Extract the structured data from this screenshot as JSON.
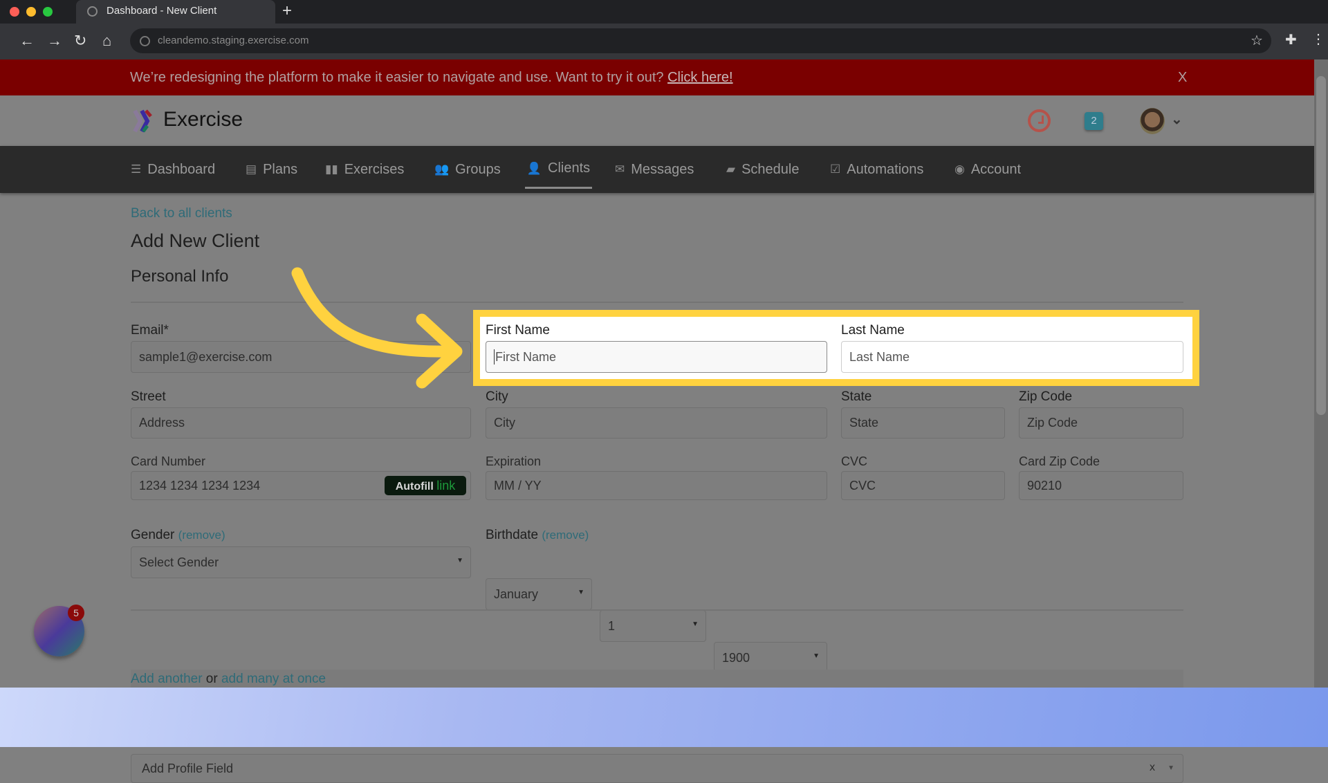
{
  "browser": {
    "tab_title": "Dashboard - New Client",
    "url": "cleandemo.staging.exercise.com"
  },
  "banner": {
    "text": "We’re redesigning the platform to make it easier to navigate and use. Want to try it out? ",
    "link": "Click here!",
    "close": "X"
  },
  "header": {
    "brand": "Exercise",
    "notification_count": "2"
  },
  "nav": {
    "items": [
      {
        "label": "Dashboard",
        "icon": "☰"
      },
      {
        "label": "Plans",
        "icon": "▤"
      },
      {
        "label": "Exercises",
        "icon": "▮▮"
      },
      {
        "label": "Groups",
        "icon": "👥"
      },
      {
        "label": "Clients",
        "icon": "👤"
      },
      {
        "label": "Messages",
        "icon": "✉"
      },
      {
        "label": "Schedule",
        "icon": "▰"
      },
      {
        "label": "Automations",
        "icon": "☑"
      },
      {
        "label": "Account",
        "icon": "◉"
      }
    ],
    "active": "Clients"
  },
  "page": {
    "back_link": "Back to all clients",
    "title": "Add New Client",
    "section": "Personal Info"
  },
  "form": {
    "email": {
      "label": "Email*",
      "value": "sample1@exercise.com"
    },
    "first_name": {
      "label": "First Name",
      "placeholder": "First Name"
    },
    "last_name": {
      "label": "Last Name",
      "placeholder": "Last Name"
    },
    "street": {
      "label": "Street",
      "placeholder": "Address"
    },
    "city": {
      "label": "City",
      "placeholder": "City"
    },
    "state": {
      "label": "State",
      "placeholder": "State"
    },
    "zip": {
      "label": "Zip Code",
      "placeholder": "Zip Code"
    },
    "card": {
      "label": "Card Number",
      "placeholder": "1234 1234 1234 1234",
      "autofill": "Autofill",
      "autofill_link": "link"
    },
    "expiration": {
      "label": "Expiration",
      "placeholder": "MM / YY"
    },
    "cvc": {
      "label": "CVC",
      "placeholder": "CVC"
    },
    "card_zip": {
      "label": "Card Zip Code",
      "value": "90210"
    },
    "gender": {
      "label": "Gender",
      "remove": "(remove)",
      "value": "Select Gender"
    },
    "birthdate": {
      "label": "Birthdate",
      "remove": "(remove)",
      "month": "January",
      "day": "1",
      "year": "1900"
    },
    "profile_field": {
      "placeholder": "Add Profile Field",
      "clear": "x"
    },
    "add_another": "Add another",
    "or": " or ",
    "add_many": "add many at once"
  },
  "fab": {
    "badge": "5"
  },
  "highlight_color": "#ffd23f"
}
